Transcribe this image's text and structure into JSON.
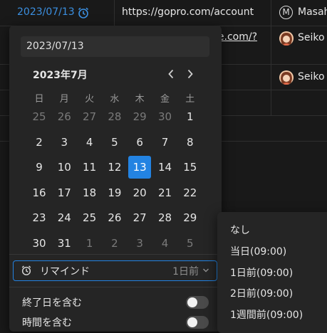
{
  "table": {
    "row1": {
      "date": "2023/07/13",
      "url": "https://gopro.com/account",
      "person": "Masahiro",
      "avatar_letter": "M"
    },
    "row2": {
      "url_fragment": "be.com/?",
      "person": "Seiko"
    },
    "row3": {
      "person": "Seiko"
    }
  },
  "picker": {
    "date_value": "2023/07/13",
    "month_label": "2023年7月",
    "weekdays": [
      "日",
      "月",
      "火",
      "水",
      "木",
      "金",
      "土"
    ],
    "weeks": [
      [
        "25",
        "26",
        "27",
        "28",
        "29",
        "30",
        "1"
      ],
      [
        "2",
        "3",
        "4",
        "5",
        "6",
        "7",
        "8"
      ],
      [
        "9",
        "10",
        "11",
        "12",
        "13",
        "14",
        "15"
      ],
      [
        "16",
        "17",
        "18",
        "19",
        "20",
        "21",
        "22"
      ],
      [
        "23",
        "24",
        "25",
        "26",
        "27",
        "28",
        "29"
      ],
      [
        "30",
        "31",
        "1",
        "2",
        "3",
        "4",
        "5"
      ]
    ],
    "selected_day": "13",
    "reminder_label": "リマインド",
    "reminder_value": "1日前",
    "include_end_date": "終了日を含む",
    "include_time": "時間を含む"
  },
  "reminder_menu": {
    "items": [
      "なし",
      "当日(09:00)",
      "1日前(09:00)",
      "2日前(09:00)",
      "1週間前(09:00)"
    ]
  },
  "colors": {
    "accent": "#2383e2",
    "link": "#3b8fe0"
  },
  "icons": {
    "alarm": "alarm-clock-icon",
    "prev": "chevron-left-icon",
    "next": "chevron-right-icon",
    "dropdown": "chevron-down-icon"
  }
}
